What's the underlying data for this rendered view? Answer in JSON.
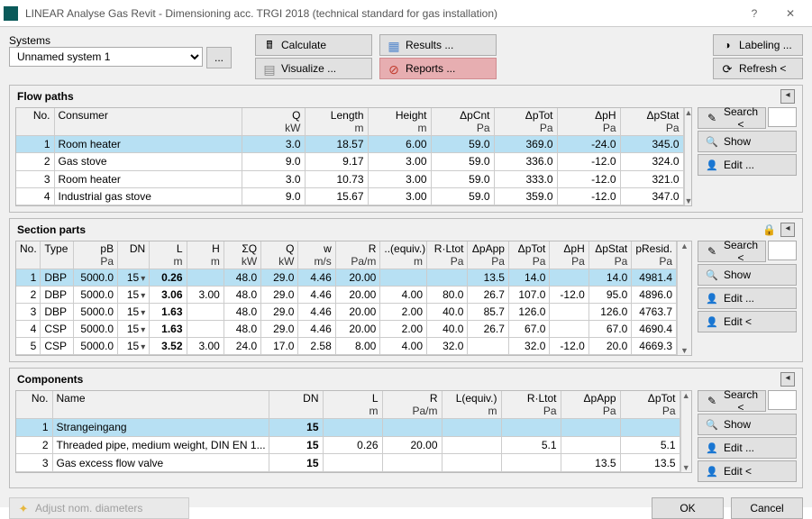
{
  "window": {
    "title": "LINEAR Analyse Gas Revit - Dimensioning acc. TRGI 2018 (technical standard for gas installation)"
  },
  "systems": {
    "label": "Systems",
    "selected": "Unnamed system 1",
    "more": "..."
  },
  "toolbar": {
    "calculate": "Calculate",
    "visualize": "Visualize ...",
    "results": "Results ...",
    "reports": "Reports ...",
    "labeling": "Labeling ...",
    "refresh": "Refresh <"
  },
  "side": {
    "search": "Search <",
    "show": "Show",
    "edit": "Edit ...",
    "edit2": "Edit <"
  },
  "bottom": {
    "adjust": "Adjust nom. diameters",
    "ok": "OK",
    "cancel": "Cancel"
  },
  "flow": {
    "title": "Flow paths",
    "cols": {
      "no": {
        "h1": "No."
      },
      "consumer": {
        "h1": "Consumer"
      },
      "q": {
        "h1": "Q",
        "h2": "kW"
      },
      "length": {
        "h1": "Length",
        "h2": "m"
      },
      "height": {
        "h1": "Height",
        "h2": "m"
      },
      "dpCnt": {
        "h1": "ΔpCnt",
        "h2": "Pa"
      },
      "dpTot": {
        "h1": "ΔpTot",
        "h2": "Pa"
      },
      "dpH": {
        "h1": "ΔpH",
        "h2": "Pa"
      },
      "dpStat": {
        "h1": "ΔpStat",
        "h2": "Pa"
      }
    },
    "rows": [
      {
        "no": "1",
        "consumer": "Room heater",
        "q": "3.0",
        "length": "18.57",
        "height": "6.00",
        "dpCnt": "59.0",
        "dpTot": "369.0",
        "dpH": "-24.0",
        "dpStat": "345.0",
        "sel": true
      },
      {
        "no": "2",
        "consumer": "Gas stove",
        "q": "9.0",
        "length": "9.17",
        "height": "3.00",
        "dpCnt": "59.0",
        "dpTot": "336.0",
        "dpH": "-12.0",
        "dpStat": "324.0"
      },
      {
        "no": "3",
        "consumer": "Room heater",
        "q": "3.0",
        "length": "10.73",
        "height": "3.00",
        "dpCnt": "59.0",
        "dpTot": "333.0",
        "dpH": "-12.0",
        "dpStat": "321.0"
      },
      {
        "no": "4",
        "consumer": "Industrial gas stove",
        "q": "9.0",
        "length": "15.67",
        "height": "3.00",
        "dpCnt": "59.0",
        "dpTot": "359.0",
        "dpH": "-12.0",
        "dpStat": "347.0"
      }
    ]
  },
  "section": {
    "title": "Section parts",
    "cols": {
      "no": {
        "h1": "No."
      },
      "type": {
        "h1": "Type"
      },
      "pb": {
        "h1": "pB",
        "h2": "Pa"
      },
      "dn": {
        "h1": "DN"
      },
      "l": {
        "h1": "L",
        "h2": "m"
      },
      "h": {
        "h1": "H",
        "h2": "m"
      },
      "sq": {
        "h1": "ΣQ",
        "h2": "kW"
      },
      "q": {
        "h1": "Q",
        "h2": "kW"
      },
      "w": {
        "h1": "w",
        "h2": "m/s"
      },
      "r": {
        "h1": "R",
        "h2": "Pa/m"
      },
      "le": {
        "h1": "..(equiv.)",
        "h2": "m"
      },
      "rl": {
        "h1": "R·Ltot",
        "h2": "Pa"
      },
      "dpApp": {
        "h1": "ΔpApp",
        "h2": "Pa"
      },
      "dpTot": {
        "h1": "ΔpTot",
        "h2": "Pa"
      },
      "dpH": {
        "h1": "ΔpH",
        "h2": "Pa"
      },
      "dpStat": {
        "h1": "ΔpStat",
        "h2": "Pa"
      },
      "pResid": {
        "h1": "pResid.",
        "h2": "Pa"
      }
    },
    "rows": [
      {
        "no": "1",
        "type": "DBP",
        "pb": "5000.0",
        "dn": "15",
        "l": "0.26",
        "h": "",
        "sq": "48.0",
        "q": "29.0",
        "w": "4.46",
        "r": "20.00",
        "le": "",
        "rl": "",
        "dpApp": "13.5",
        "dpTot": "14.0",
        "dpH": "",
        "dpStat": "14.0",
        "pResid": "4981.4",
        "sel": true
      },
      {
        "no": "2",
        "type": "DBP",
        "pb": "5000.0",
        "dn": "15",
        "l": "3.06",
        "h": "3.00",
        "sq": "48.0",
        "q": "29.0",
        "w": "4.46",
        "r": "20.00",
        "le": "4.00",
        "rl": "80.0",
        "dpApp": "26.7",
        "dpTot": "107.0",
        "dpH": "-12.0",
        "dpStat": "95.0",
        "pResid": "4896.0"
      },
      {
        "no": "3",
        "type": "DBP",
        "pb": "5000.0",
        "dn": "15",
        "l": "1.63",
        "h": "",
        "sq": "48.0",
        "q": "29.0",
        "w": "4.46",
        "r": "20.00",
        "le": "2.00",
        "rl": "40.0",
        "dpApp": "85.7",
        "dpTot": "126.0",
        "dpH": "",
        "dpStat": "126.0",
        "pResid": "4763.7"
      },
      {
        "no": "4",
        "type": "CSP",
        "pb": "5000.0",
        "dn": "15",
        "l": "1.63",
        "h": "",
        "sq": "48.0",
        "q": "29.0",
        "w": "4.46",
        "r": "20.00",
        "le": "2.00",
        "rl": "40.0",
        "dpApp": "26.7",
        "dpTot": "67.0",
        "dpH": "",
        "dpStat": "67.0",
        "pResid": "4690.4"
      },
      {
        "no": "5",
        "type": "CSP",
        "pb": "5000.0",
        "dn": "15",
        "l": "3.52",
        "h": "3.00",
        "sq": "24.0",
        "q": "17.0",
        "w": "2.58",
        "r": "8.00",
        "le": "4.00",
        "rl": "32.0",
        "dpApp": "",
        "dpTot": "32.0",
        "dpH": "-12.0",
        "dpStat": "20.0",
        "pResid": "4669.3"
      }
    ]
  },
  "components": {
    "title": "Components",
    "cols": {
      "no": {
        "h1": "No."
      },
      "name": {
        "h1": "Name"
      },
      "dn": {
        "h1": "DN"
      },
      "l": {
        "h1": "L",
        "h2": "m"
      },
      "r": {
        "h1": "R",
        "h2": "Pa/m"
      },
      "le": {
        "h1": "L(equiv.)",
        "h2": "m"
      },
      "rl": {
        "h1": "R·Ltot",
        "h2": "Pa"
      },
      "dpApp": {
        "h1": "ΔpApp",
        "h2": "Pa"
      },
      "dpTot": {
        "h1": "ΔpTot",
        "h2": "Pa"
      }
    },
    "rows": [
      {
        "no": "1",
        "name": "Strangeingang",
        "dn": "15",
        "l": "",
        "r": "",
        "le": "",
        "rl": "",
        "dpApp": "",
        "dpTot": "",
        "sel": true
      },
      {
        "no": "2",
        "name": "Threaded pipe, medium weight, DIN EN 1...",
        "dn": "15",
        "l": "0.26",
        "r": "20.00",
        "le": "",
        "rl": "5.1",
        "dpApp": "",
        "dpTot": "5.1"
      },
      {
        "no": "3",
        "name": "Gas excess flow valve",
        "dn": "15",
        "l": "",
        "r": "",
        "le": "",
        "rl": "",
        "dpApp": "13.5",
        "dpTot": "13.5"
      }
    ]
  }
}
